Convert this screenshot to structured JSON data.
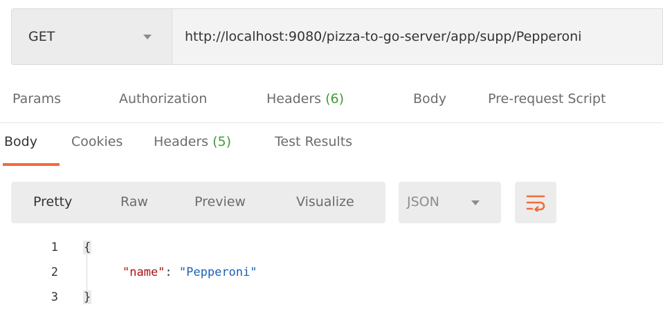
{
  "request": {
    "method": "GET",
    "url": "http://localhost:9080/pizza-to-go-server/app/supp/Pepperoni"
  },
  "request_tabs": [
    {
      "label": "Params",
      "count": ""
    },
    {
      "label": "Authorization",
      "count": ""
    },
    {
      "label": "Headers",
      "count": "(6)"
    },
    {
      "label": "Body",
      "count": ""
    },
    {
      "label": "Pre-request Script",
      "count": ""
    }
  ],
  "response_tabs": [
    {
      "label": "Body",
      "count": ""
    },
    {
      "label": "Cookies",
      "count": ""
    },
    {
      "label": "Headers",
      "count": "(5)"
    },
    {
      "label": "Test Results",
      "count": ""
    }
  ],
  "format": {
    "options": [
      "Pretty",
      "Raw",
      "Preview",
      "Visualize"
    ],
    "selected": "Pretty",
    "language": "JSON",
    "wrap_icon": "wrap-lines-icon",
    "accent_color": "#f26b3a"
  },
  "code": {
    "line_numbers": [
      "1",
      "2",
      "3"
    ],
    "open_brace": "{",
    "close_brace": "}",
    "key": "\"name\"",
    "colon": ": ",
    "value": "\"Pepperoni\""
  }
}
